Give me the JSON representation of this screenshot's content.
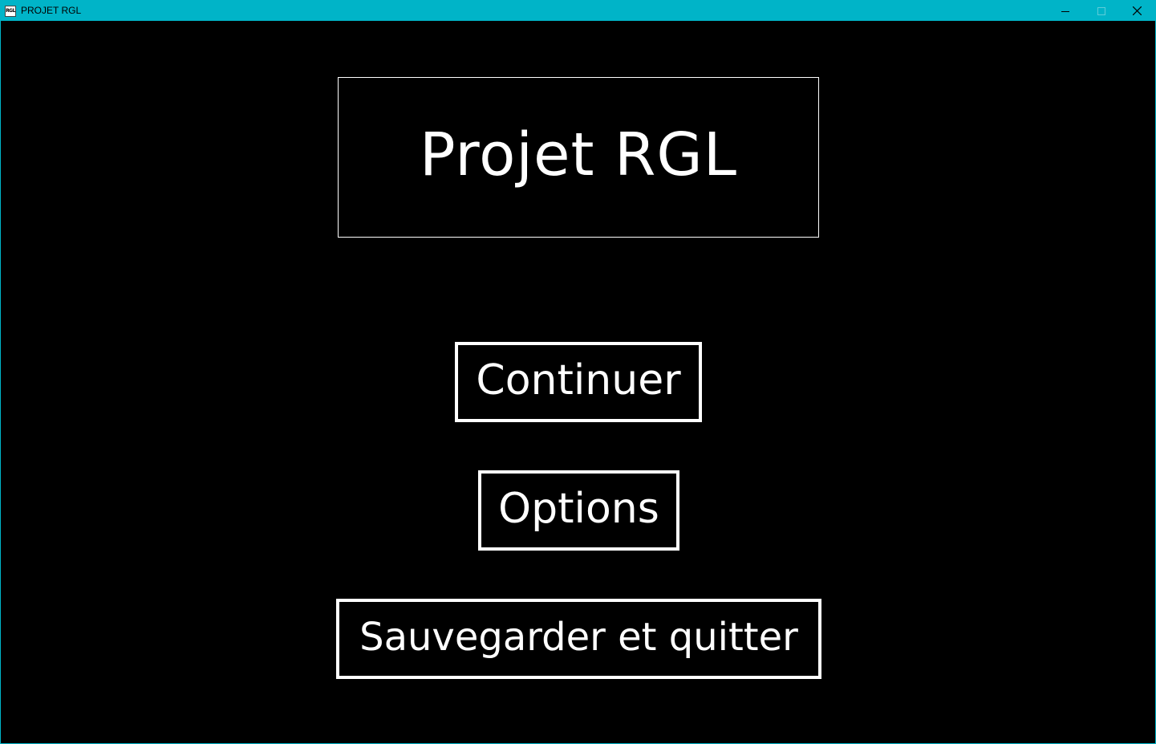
{
  "window": {
    "title": "PROJET RGL",
    "icon_label": "RGL",
    "titlebar_color": "#00b4c8"
  },
  "game": {
    "title": "Projet RGL"
  },
  "menu": {
    "continue_label": "Continuer",
    "options_label": "Options",
    "save_quit_label": "Sauvegarder et quitter"
  },
  "icons": {
    "minimize": "minimize-icon",
    "maximize": "maximize-icon",
    "close": "close-icon"
  },
  "colors": {
    "background": "#000000",
    "foreground": "#ffffff"
  }
}
